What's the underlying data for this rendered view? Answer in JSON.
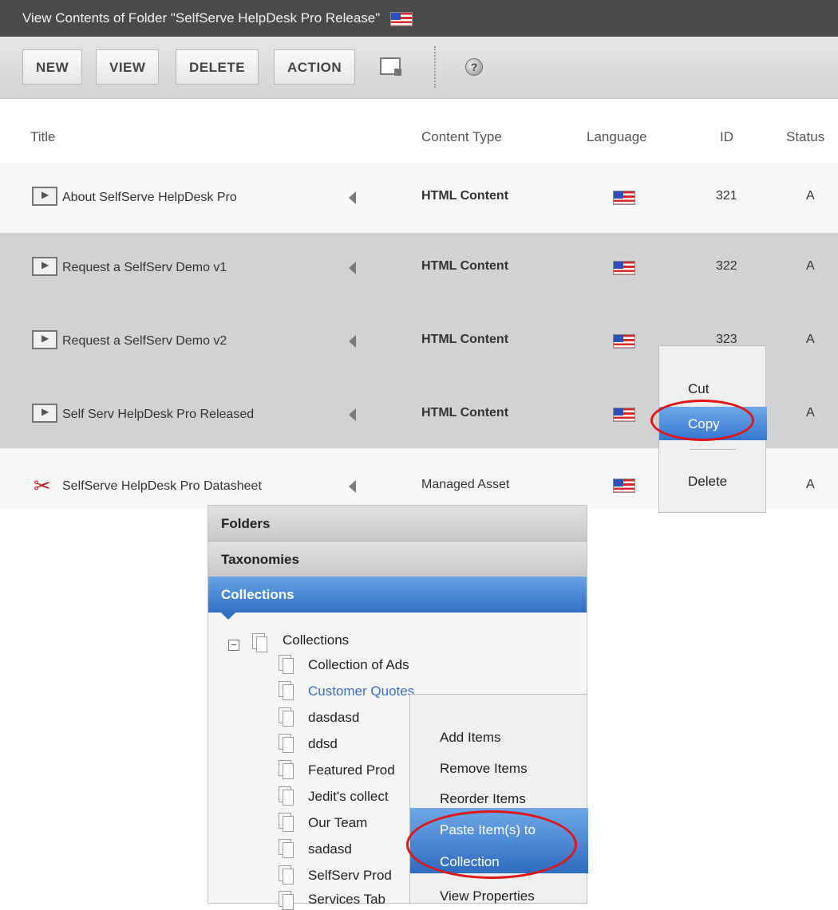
{
  "window": {
    "title": "View Contents of Folder \"SelfServe HelpDesk Pro Release\""
  },
  "toolbar": {
    "buttons": [
      "NEW",
      "VIEW",
      "DELETE",
      "ACTION"
    ],
    "icons": [
      "copy-window-icon",
      "help-icon"
    ]
  },
  "table": {
    "columns": [
      "Title",
      "Content Type",
      "Language",
      "ID",
      "Status"
    ],
    "rows": [
      {
        "title": "About SelfServe HelpDesk Pro",
        "type": "HTML Content",
        "id": "321",
        "status": "A",
        "icon": "html-content-icon"
      },
      {
        "title": "Request a SelfServ Demo v1",
        "type": "HTML Content",
        "id": "322",
        "status": "A",
        "icon": "html-content-icon"
      },
      {
        "title": "Request a SelfServ Demo v2",
        "type": "HTML Content",
        "id": "323",
        "status": "A",
        "icon": "html-content-icon"
      },
      {
        "title": "Self Serv HelpDesk Pro Released",
        "type": "HTML Content",
        "id": "",
        "status": "A",
        "icon": "html-content-icon"
      },
      {
        "title": "SelfServe HelpDesk Pro Datasheet",
        "type": "Managed Asset",
        "id": "",
        "status": "A",
        "icon": "pdf-icon"
      }
    ]
  },
  "context_menu_1": {
    "items": [
      "Cut",
      "Copy",
      "Delete"
    ],
    "highlighted": "Copy"
  },
  "accordion": {
    "sections": [
      "Folders",
      "Taxonomies",
      "Collections"
    ],
    "active": "Collections"
  },
  "tree": {
    "root": "Collections",
    "items": [
      "Collection of Ads",
      "Customer Quotes",
      "dasdasd",
      "ddsd",
      "Featured Prod",
      "Jedit's collect",
      "Our Team",
      "sadasd",
      "SelfServ Prod",
      "Services Tab"
    ]
  },
  "context_menu_2": {
    "items": [
      "Add Items",
      "Remove Items",
      "Reorder Items",
      "Paste Item(s) to",
      "Collection",
      "View Properties"
    ],
    "highlighted": "Paste Item(s) to Collection"
  },
  "colors": {
    "titlebar": "#4a4a4a",
    "highlight": "#3576cf",
    "annotation": "#e01515"
  }
}
